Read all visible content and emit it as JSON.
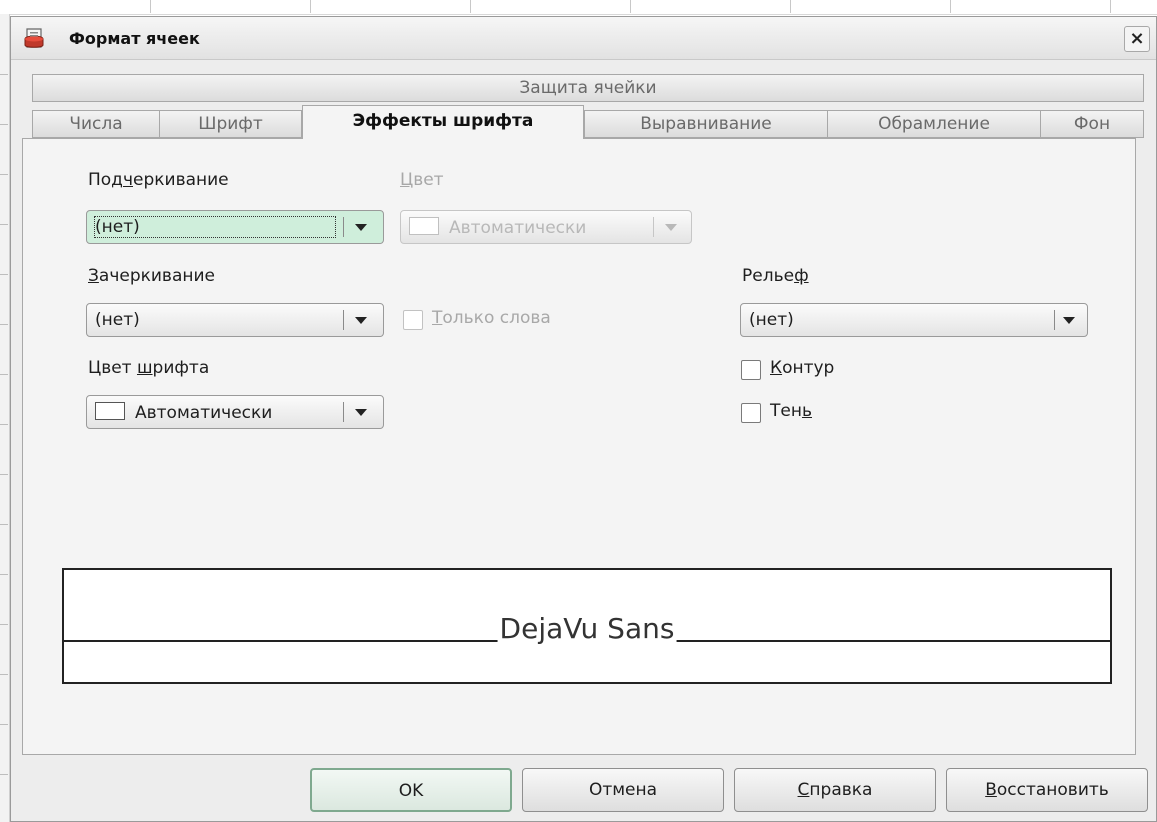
{
  "dialog": {
    "title": "Формат ячеек",
    "close_glyph": "×",
    "title_icon": "spreadsheet-app-icon"
  },
  "tabs_row1": [
    "Защита ячейки"
  ],
  "tabs_row2": [
    "Числа",
    "Шрифт",
    "Эффекты шрифта",
    "Выравнивание",
    "Обрамление",
    "Фон"
  ],
  "active_tab": "Эффекты шрифта",
  "underline": {
    "label_pre": "Под",
    "label_key": "ч",
    "label_post": "еркивание",
    "value": "(нет)"
  },
  "color": {
    "label_key": "Ц",
    "label_post": "вет",
    "value": "Автоматически",
    "disabled": true
  },
  "strikethrough": {
    "label_key": "З",
    "label_post": "ачеркивание",
    "value": "(нет)"
  },
  "words_only": {
    "label_key": "Т",
    "label_post": "олько слова",
    "checked": false,
    "disabled": true
  },
  "relief": {
    "label_pre": "Релье",
    "label_key": "ф",
    "value": "(нет)"
  },
  "font_color": {
    "label_pre": "Цвет ",
    "label_key": "ш",
    "label_post": "рифта",
    "value": "Автоматически"
  },
  "outline": {
    "label_key": "К",
    "label_post": "онтур",
    "checked": false
  },
  "shadow": {
    "label_pre": "Тен",
    "label_key": "ь",
    "checked": false
  },
  "preview": {
    "text": "DejaVu Sans"
  },
  "buttons": {
    "ok": "OK",
    "cancel": "Отмена",
    "help_key": "С",
    "help_post": "правка",
    "reset_key": "В",
    "reset_post": "осстановить"
  },
  "colors": {
    "focus_fill": "#cfeedb",
    "default_button_border": "#7fa98f",
    "disabled_text": "#a8a8a8"
  }
}
